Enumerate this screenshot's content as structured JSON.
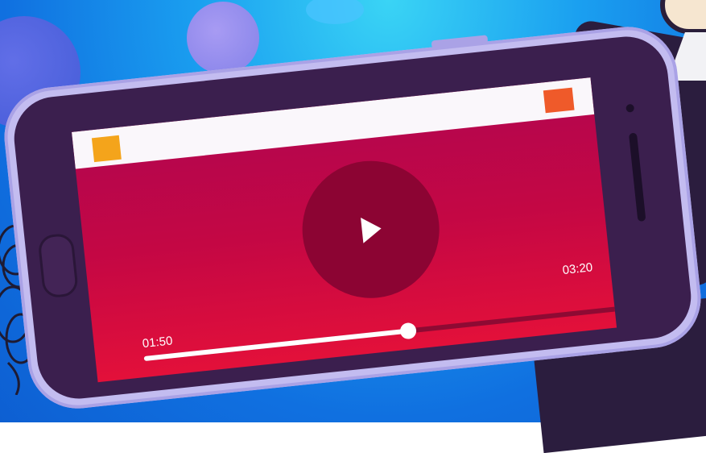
{
  "player": {
    "time_current": "01:50",
    "time_total": "03:20",
    "progress_fraction": 0.55,
    "play_icon": "play-icon"
  },
  "colors": {
    "background": "#1a9ff0",
    "phone_body": "#c3bcf0",
    "screen_top": "#b2064f",
    "screen_bottom": "#e3103a",
    "play_circle": "#8c0433",
    "accent_yellow": "#f4a41b",
    "accent_orange": "#ef5a2a"
  }
}
